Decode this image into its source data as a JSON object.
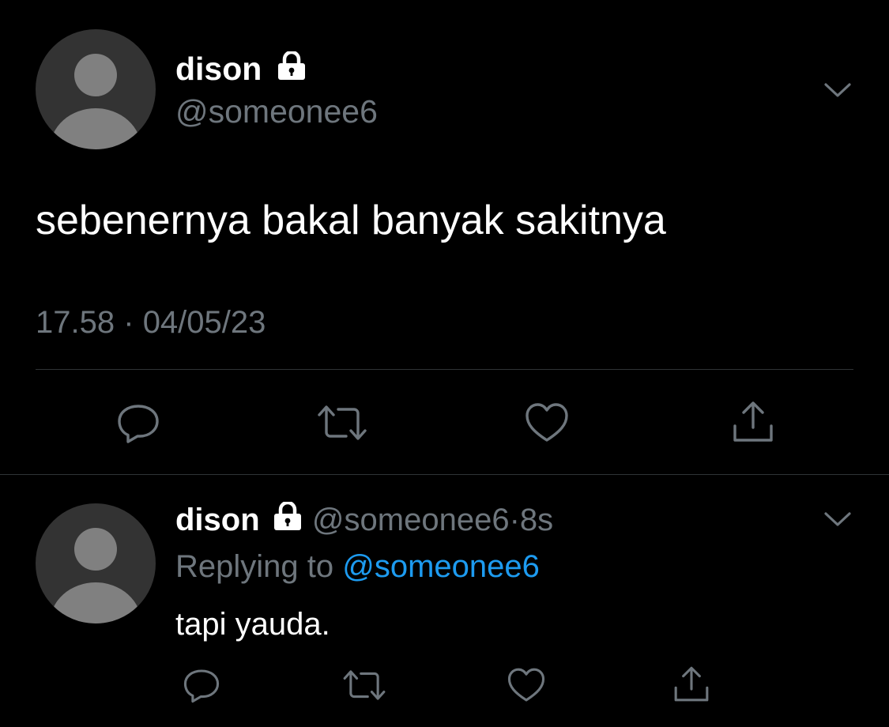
{
  "main_tweet": {
    "display_name": "dison",
    "handle": "@someonee6",
    "text": "sebenernya bakal banyak sakitnya",
    "time": "17.58",
    "separator": "·",
    "date": "04/05/23",
    "avatar_icon": "default-avatar-icon",
    "badge_icon": "lock-icon",
    "menu_icon": "chevron-down-icon"
  },
  "reply_tweet": {
    "display_name": "dison",
    "handle": "@someonee6",
    "separator": "·",
    "age": "8s",
    "replying_label": "Replying to",
    "replying_handle": "@someonee6",
    "text": "tapi yauda.",
    "avatar_icon": "default-avatar-icon",
    "badge_icon": "lock-icon",
    "menu_icon": "chevron-down-icon"
  },
  "actions": [
    "reply-icon",
    "retweet-icon",
    "like-icon",
    "share-icon"
  ],
  "colors": {
    "background": "#000000",
    "text": "#ffffff",
    "muted": "#6e767d",
    "link": "#1d9bf0",
    "divider": "#2f3336",
    "avatar_bg": "#333333",
    "avatar_fg": "#808080"
  }
}
